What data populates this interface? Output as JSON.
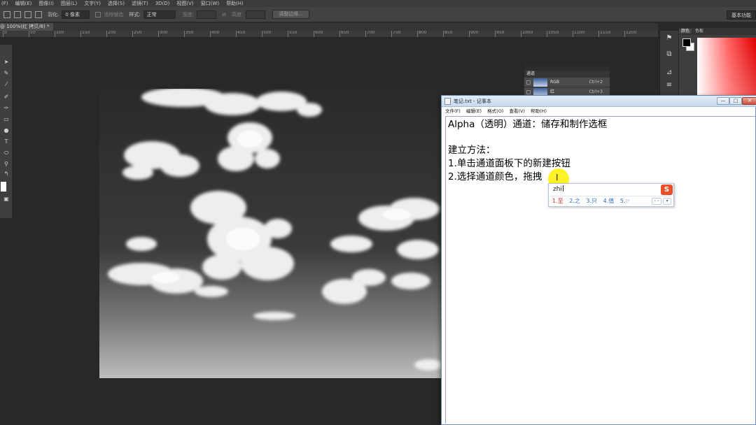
{
  "photoshop": {
    "menubar": [
      "(F)",
      "编辑(E)",
      "图像(I)",
      "图层(L)",
      "文字(Y)",
      "选择(S)",
      "滤镜(T)",
      "3D(D)",
      "视图(V)",
      "窗口(W)",
      "帮助(H)"
    ],
    "options": {
      "feather_label": "羽化:",
      "feather_value": "0 像素",
      "antialias_label": "消除锯齿",
      "style_label": "样式:",
      "style_value": "正常",
      "width_label": "宽度:",
      "height_label": "高度:",
      "refine_edge_label": "调整边缘...",
      "workspace_label": "基本功能"
    },
    "doc_tab": "@ 100%(红 拷贝/8) *",
    "ruler_ticks": [
      "0",
      "50",
      "100",
      "150",
      "200",
      "250",
      "300",
      "350",
      "400",
      "450",
      "500",
      "550",
      "600",
      "650",
      "700",
      "750",
      "800",
      "850",
      "900",
      "950",
      "1000",
      "1050",
      "1100",
      "1150",
      "1200"
    ],
    "color_panel": {
      "tabs": [
        "颜色",
        "色板"
      ],
      "accent_red": "#e00000"
    },
    "channels_panel": {
      "tab_label": "通道",
      "rows": [
        {
          "name": "RGB",
          "shortcut": "Ctrl+2"
        },
        {
          "name": "红",
          "shortcut": "Ctrl+3"
        }
      ]
    }
  },
  "notepad": {
    "title": "笔记.txt - 记事本",
    "menu": [
      "文件(F)",
      "编辑(E)",
      "格式(O)",
      "查看(V)",
      "帮助(H)"
    ],
    "lines": [
      "Alpha（透明）通道：储存和制作选框",
      "",
      "建立方法：",
      "1.单击通道面板下的新建按钮",
      "2.选择通道颜色，拖拽"
    ],
    "controls": {
      "min": "—",
      "max": "□",
      "close": "✕"
    }
  },
  "ime": {
    "input": "zhi",
    "logo": "S",
    "candidates": [
      "1.至",
      "2.之",
      "3.只",
      "4.值",
      "5.☞"
    ],
    "nav": "‹ ›",
    "more": "▾"
  }
}
